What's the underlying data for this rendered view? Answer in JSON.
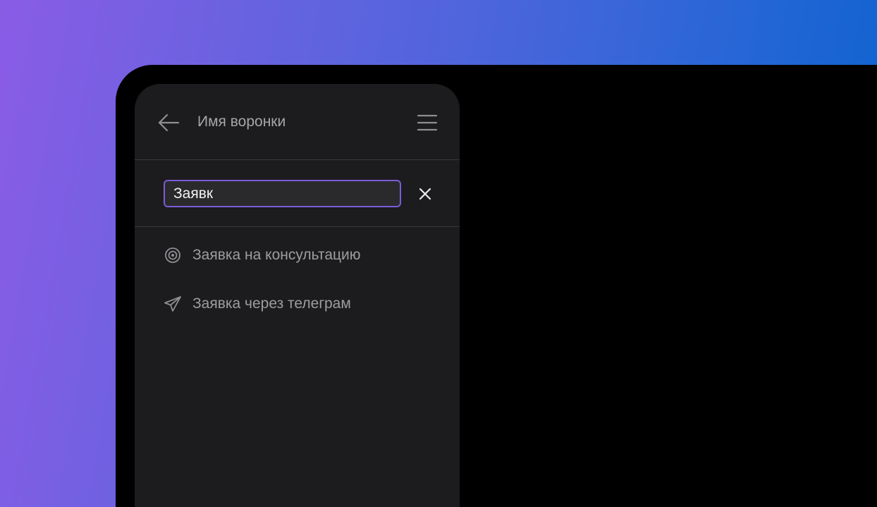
{
  "header": {
    "title": "Имя воронки",
    "back_icon": "arrow-left-icon",
    "menu_icon": "hamburger-menu-icon"
  },
  "search": {
    "value": "Заявк",
    "clear_icon": "close-icon"
  },
  "results": [
    {
      "label": "Заявка на консультацию",
      "icon": "target-icon"
    },
    {
      "label": "Заявка через телеграм",
      "icon": "telegram-icon"
    }
  ],
  "colors": {
    "accent": "#7b5cd6",
    "panel_bg": "#1c1c1e",
    "text_muted": "#9d9da2"
  }
}
